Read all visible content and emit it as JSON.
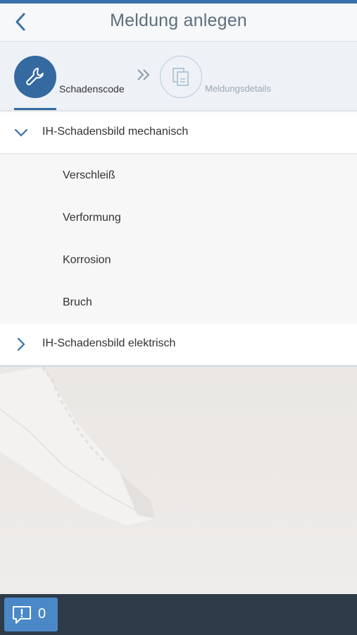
{
  "header": {
    "title": "Meldung anlegen"
  },
  "wizard": {
    "steps": [
      {
        "label": "Schadenscode",
        "icon": "wrench-icon",
        "active": true
      },
      {
        "label": "Meldungsdetails",
        "icon": "documents-icon",
        "active": false
      }
    ]
  },
  "list": {
    "groups": [
      {
        "label": "IH-Schadensbild mechanisch",
        "expanded": true,
        "items": [
          "Verschleiß",
          "Verformung",
          "Korrosion",
          "Bruch"
        ]
      },
      {
        "label": "IH-Schadensbild elektrisch",
        "expanded": false
      }
    ]
  },
  "footer": {
    "message_count": "0"
  },
  "colors": {
    "accent": "#346aa0",
    "footer": "#2e3c49",
    "message_button": "#4b88c8"
  }
}
